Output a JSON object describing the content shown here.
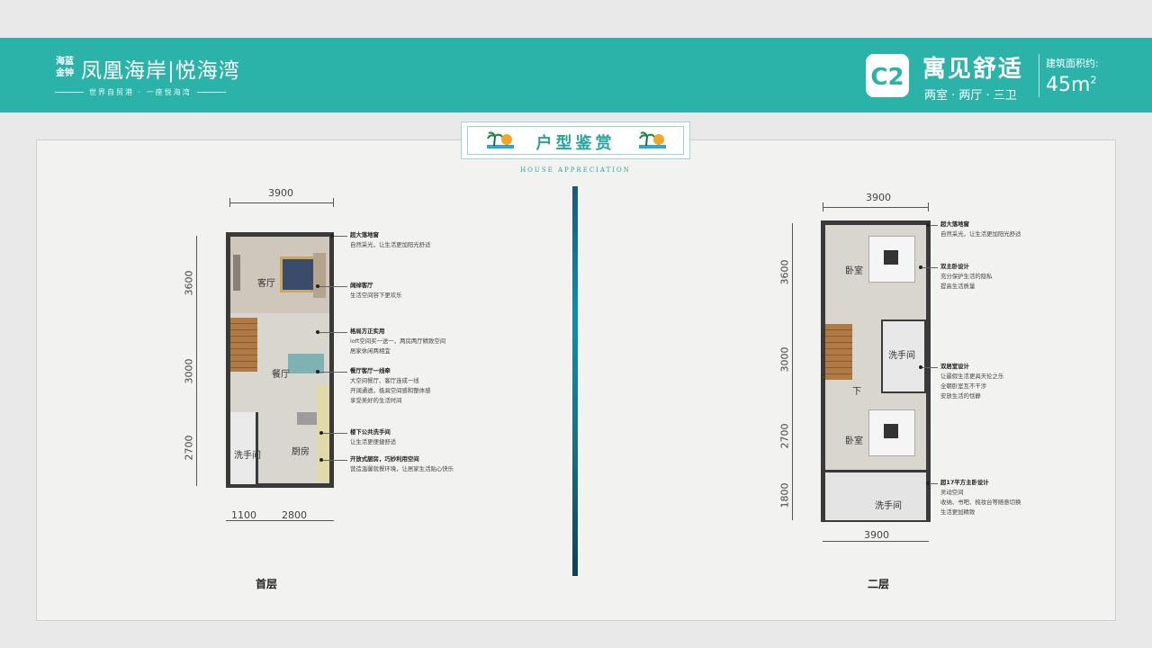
{
  "header": {
    "logo_small": "海蓝金钟",
    "logo_main": "凤凰海岸|悦海湾",
    "logo_tag": "世界自贸港 · 一座悦海湾",
    "unit_code": "C2",
    "unit_title": "寓见舒适",
    "unit_sub": "两室 · 两厅 · 三卫",
    "area_label": "建筑面积约:",
    "area_value": "45m",
    "area_sup": "2"
  },
  "section": {
    "title": "户型鉴赏",
    "subtitle": "HOUSE APPRECIATION"
  },
  "floor1": {
    "name": "首层",
    "dims": {
      "top": "3900",
      "left_1": "3600",
      "left_2": "3000",
      "left_3": "2700",
      "bottom_1": "1100",
      "bottom_2": "2800"
    },
    "rooms": {
      "living": "客厅",
      "dining": "餐厅",
      "kitchen": "厨房",
      "bath": "洗手间"
    },
    "callouts": [
      {
        "title": "超大落地窗",
        "lines": [
          "自然采光，让生活更加阳光舒适"
        ]
      },
      {
        "title": "阔绰客厅",
        "lines": [
          "生活空间容下更欢乐"
        ]
      },
      {
        "title": "格局方正实用",
        "lines": [
          "loft空间买一送一，两房两厅精致空间",
          "居家休闲两相宜"
        ]
      },
      {
        "title": "餐厅客厅一线牵",
        "lines": [
          "大空间餐厅、客厅连成一线",
          "开阔通透，极具空间感和整体感",
          "享受美好的生活时间"
        ]
      },
      {
        "title": "楼下公共洗手间",
        "lines": [
          "让生活更便捷舒适"
        ]
      },
      {
        "title": "开放式厨房，巧妙利用空间",
        "lines": [
          "营造温馨就餐环境，让居家生活贴心快乐"
        ]
      }
    ]
  },
  "floor2": {
    "name": "二层",
    "dims": {
      "top": "3900",
      "left_1": "3600",
      "left_2": "3000",
      "left_3": "2700",
      "left_4": "1800",
      "bottom": "3900"
    },
    "rooms": {
      "bed1": "卧室",
      "bath1": "洗手间",
      "down": "下",
      "bed2": "卧室",
      "bath2": "洗手间"
    },
    "callouts": [
      {
        "title": "超大落地窗",
        "lines": [
          "自然采光，让生活更加阳光舒适"
        ]
      },
      {
        "title": "双主卧设计",
        "lines": [
          "充分保护生活的隐私",
          "提高生活质量"
        ]
      },
      {
        "title": "双居室设计",
        "lines": [
          "让最假生活更具天伦之乐",
          "全朝卧室互不干涉",
          "安放生活的恬静"
        ]
      },
      {
        "title": "超17平方主卧设计",
        "lines": [
          "灵动空间",
          "收纳、书吧、梳妆台等随意切换",
          "生活更加精致"
        ]
      }
    ]
  },
  "colors": {
    "brand": "#2bb3aa",
    "divider": "#0e8fa6"
  }
}
